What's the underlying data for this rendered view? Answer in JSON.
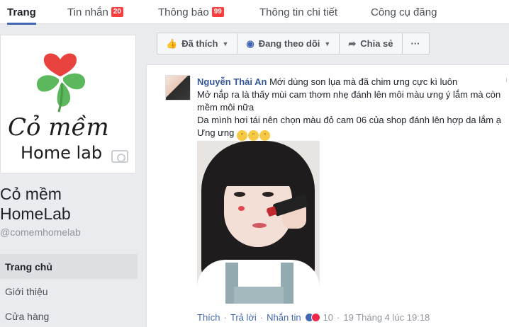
{
  "tabs": [
    {
      "label": "Trang"
    },
    {
      "label": "Tin nhắn",
      "badge": "20"
    },
    {
      "label": "Thông báo",
      "badge": "99"
    },
    {
      "label": "Thông tin chi tiết"
    },
    {
      "label": "Công cụ đăng"
    }
  ],
  "page": {
    "logo_text_top": "Cỏ mềm",
    "logo_text_bottom": "Home lab",
    "name": "Cỏ mềm HomeLab",
    "handle": "@comemhomelab"
  },
  "nav": [
    {
      "label": "Trang chủ"
    },
    {
      "label": "Giới thiệu"
    },
    {
      "label": "Cửa hàng"
    }
  ],
  "actions": {
    "liked": "Đã thích",
    "following": "Đang theo dõi",
    "share": "Chia sẻ",
    "more": "···"
  },
  "comment": {
    "author": "Nguyễn Thái An",
    "line1": "Mới dùng son lụa mà đã chim ưng cực kì luôn",
    "line2": "Mở nắp ra là thấy mùi cam thơm nhẹ đánh lên môi màu ưng ý lắm mà còn mềm môi nữa",
    "line3": "Da mình hơi tái nên chọn màu đỏ cam 06 của shop đánh lên hợp da lắm ạ",
    "line4": "Ưng ưng",
    "actions": {
      "like": "Thích",
      "reply": "Trả lời",
      "message": "Nhắn tin",
      "reaction_count": "10",
      "timestamp": "19 Tháng 4 lúc 19:18"
    }
  },
  "colors": {
    "accent": "#4267b2",
    "badge": "#fa3e3e",
    "logo_heart": "#e8423f",
    "logo_leaf": "#5cb85c"
  }
}
